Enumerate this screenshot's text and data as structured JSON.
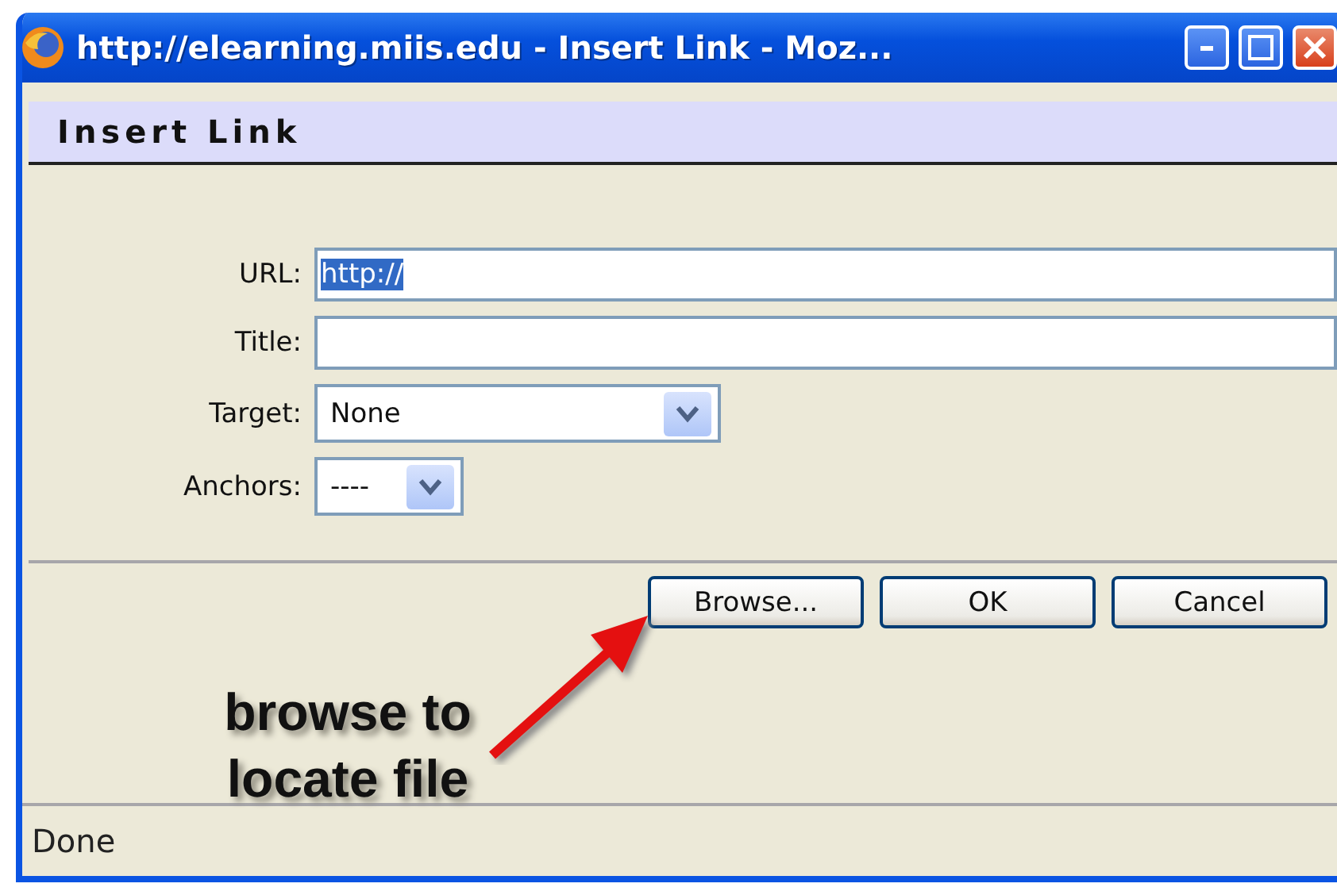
{
  "window": {
    "title": "http://elearning.miis.edu - Insert Link - Moz..."
  },
  "header": {
    "title": "Insert Link"
  },
  "fields": [
    {
      "kind": "text",
      "label": "URL:",
      "value": "http://",
      "text_selected": true
    },
    {
      "kind": "text",
      "label": "Title:"
    },
    {
      "kind": "select_wide",
      "label": "Target:",
      "value": "None"
    },
    {
      "kind": "select_narrow",
      "label": "Anchors:",
      "value": "----"
    }
  ],
  "buttons": [
    "Browse...",
    "OK",
    "Cancel"
  ],
  "annotation": {
    "text": "browse to locate file"
  },
  "status_bar": {
    "text": "Done"
  }
}
